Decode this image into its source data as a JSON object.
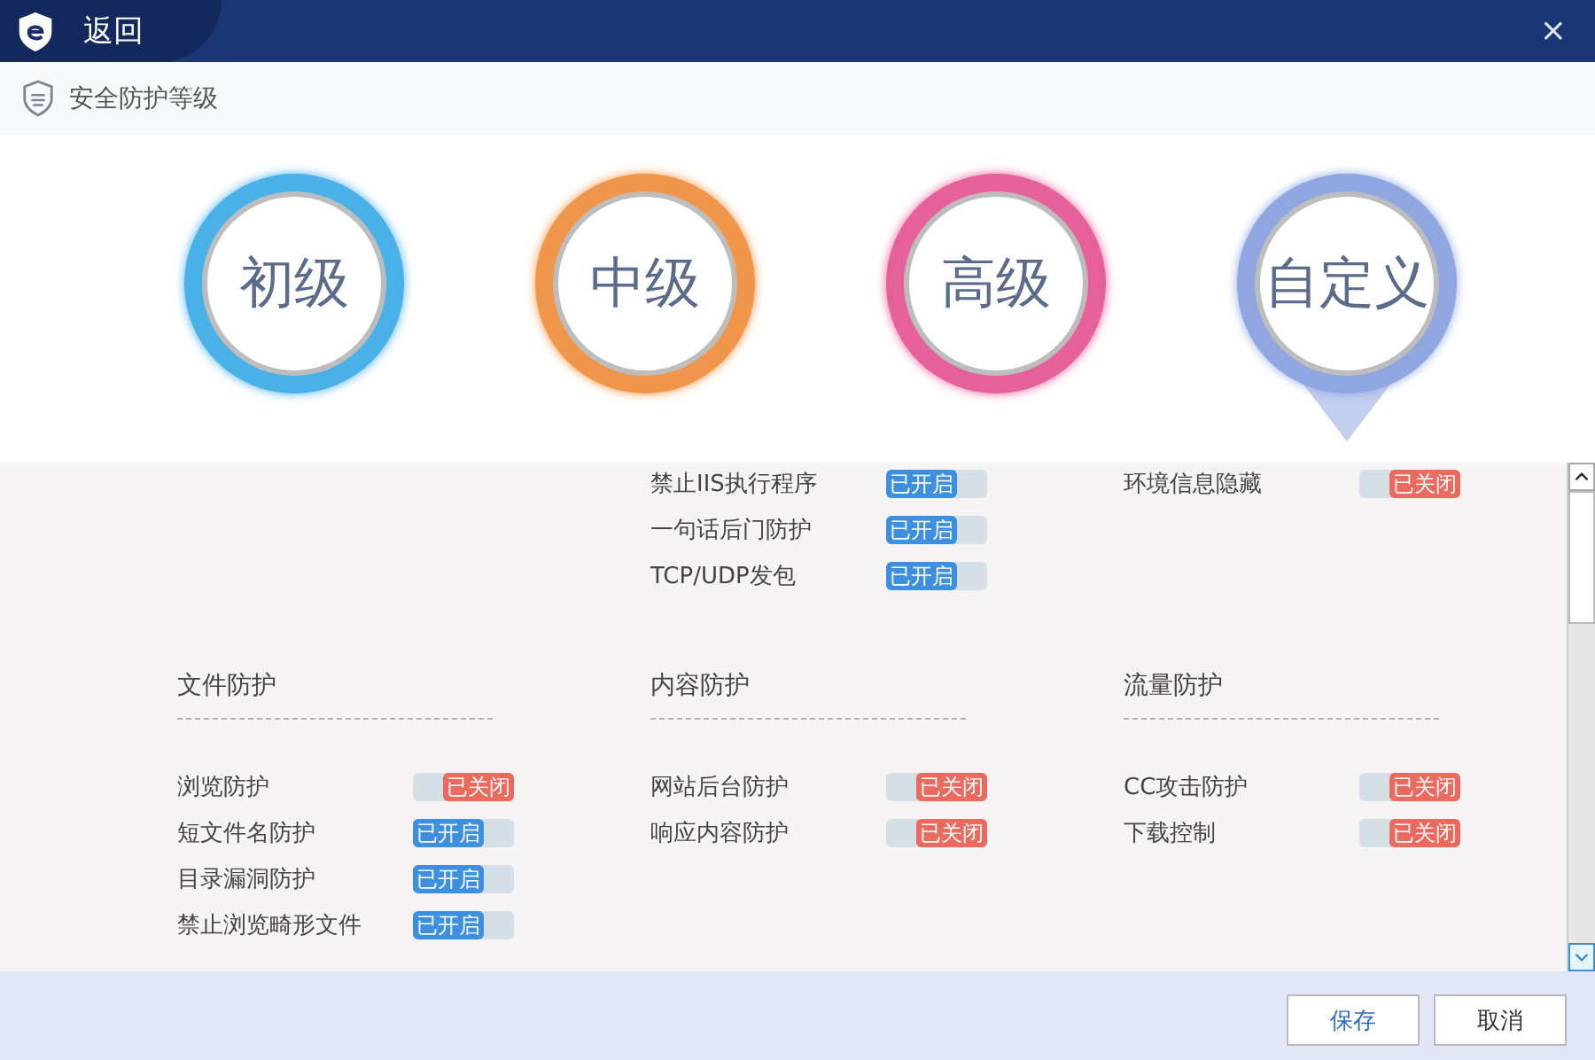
{
  "title_bar": {
    "back_label": "返回",
    "close_glyph": "×"
  },
  "header": {
    "title": "安全防护等级"
  },
  "levels": [
    {
      "label": "初级",
      "color": "#4ab0e8",
      "selected": false
    },
    {
      "label": "中级",
      "color": "#f0964a",
      "selected": false
    },
    {
      "label": "高级",
      "color": "#e6609a",
      "selected": false
    },
    {
      "label": "自定义",
      "color": "#8fa6e0",
      "selected": true
    }
  ],
  "sections": [
    {
      "columns": [
        null,
        {
          "items": [
            {
              "label": "禁止IIS执行程序",
              "status": "已开启",
              "on": true
            },
            {
              "label": "一句话后门防护",
              "status": "已开启",
              "on": true
            },
            {
              "label": "TCP/UDP发包",
              "status": "已开启",
              "on": true
            }
          ]
        },
        {
          "items": [
            {
              "label": "环境信息隐藏",
              "status": "已关闭",
              "on": false
            }
          ]
        }
      ]
    },
    {
      "columns": [
        {
          "title": "文件防护",
          "items": [
            {
              "label": "浏览防护",
              "status": "已关闭",
              "on": false
            },
            {
              "label": "短文件名防护",
              "status": "已开启",
              "on": true
            },
            {
              "label": "目录漏洞防护",
              "status": "已开启",
              "on": true
            },
            {
              "label": "禁止浏览畸形文件",
              "status": "已开启",
              "on": true
            }
          ]
        },
        {
          "title": "内容防护",
          "items": [
            {
              "label": "网站后台防护",
              "status": "已关闭",
              "on": false
            },
            {
              "label": "响应内容防护",
              "status": "已关闭",
              "on": false
            }
          ]
        },
        {
          "title": "流量防护",
          "items": [
            {
              "label": "CC攻击防护",
              "status": "已关闭",
              "on": false
            },
            {
              "label": "下载控制",
              "status": "已关闭",
              "on": false
            }
          ]
        }
      ]
    }
  ],
  "buttons": [
    {
      "label": "保存",
      "kind": "primary"
    },
    {
      "label": "取消",
      "kind": "normal"
    }
  ]
}
